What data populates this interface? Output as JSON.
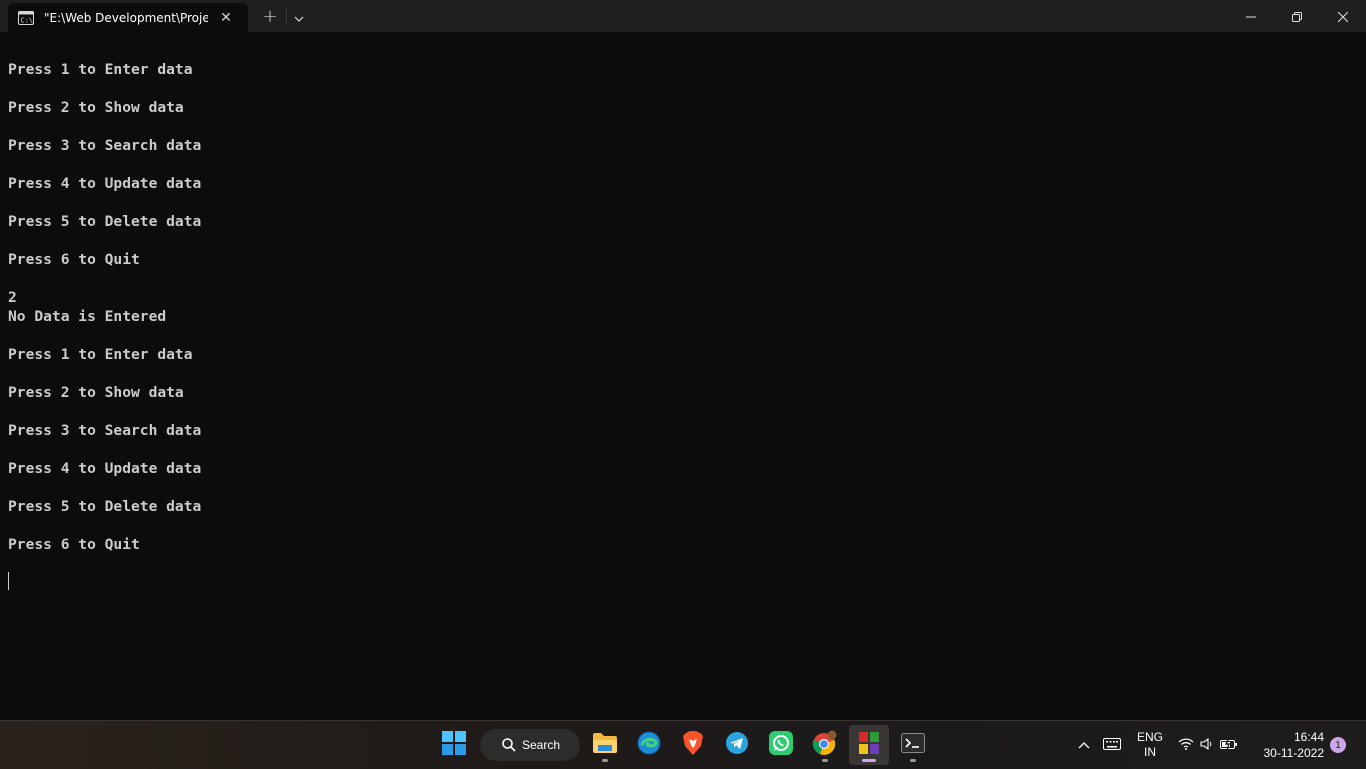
{
  "window": {
    "tab_title": "\"E:\\Web Development\\Project",
    "close_tab_symbol": "✕",
    "new_tab_symbol": "+"
  },
  "terminal": {
    "lines": [
      "Press 1 to Enter data",
      "",
      "Press 2 to Show data",
      "",
      "Press 3 to Search data",
      "",
      "Press 4 to Update data",
      "",
      "Press 5 to Delete data",
      "",
      "Press 6 to Quit",
      "",
      "2",
      "No Data is Entered",
      "",
      "Press 1 to Enter data",
      "",
      "Press 2 to Show data",
      "",
      "Press 3 to Search data",
      "",
      "Press 4 to Update data",
      "",
      "Press 5 to Delete data",
      "",
      "Press 6 to Quit"
    ]
  },
  "taskbar": {
    "search_label": "Search",
    "apps": [
      {
        "name": "start-button-icon"
      },
      {
        "name": "file-explorer-icon"
      },
      {
        "name": "edge-icon"
      },
      {
        "name": "brave-icon"
      },
      {
        "name": "telegram-icon"
      },
      {
        "name": "whatsapp-icon"
      },
      {
        "name": "chrome-icon"
      },
      {
        "name": "winrar-icon"
      },
      {
        "name": "terminal-icon"
      }
    ],
    "language": {
      "line1": "ENG",
      "line2": "IN"
    },
    "clock": {
      "time": "16:44",
      "date": "30-11-2022"
    },
    "notification_count": "1"
  }
}
